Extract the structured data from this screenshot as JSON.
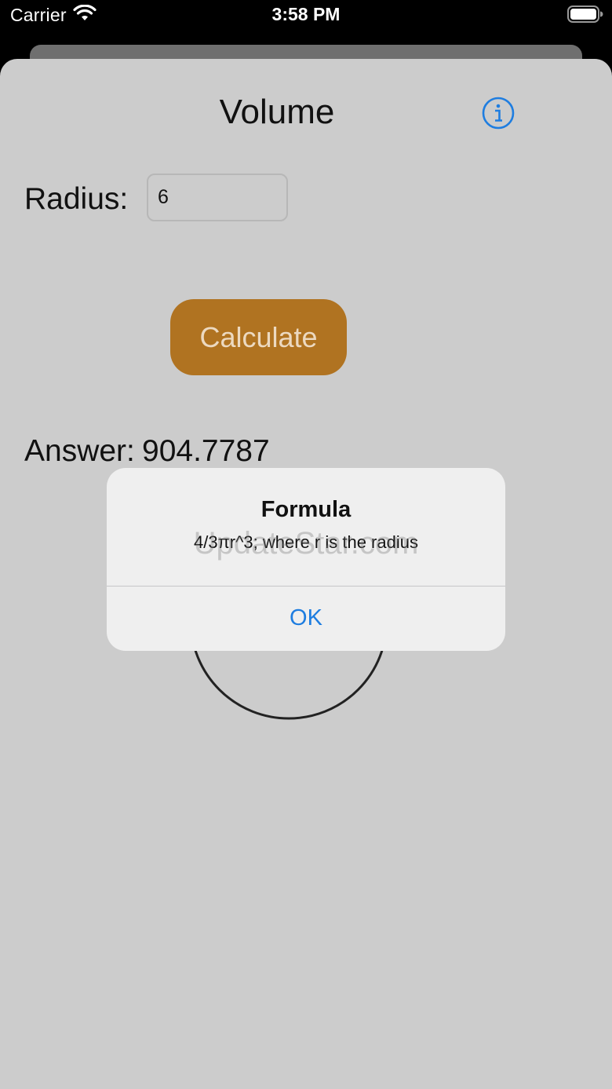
{
  "status_bar": {
    "carrier": "Carrier",
    "time": "3:58 PM",
    "icons": [
      "wifi-icon",
      "battery-icon"
    ]
  },
  "screen": {
    "title": "Volume",
    "info_icon": "info-circle-icon",
    "radius_label": "Radius:",
    "radius_value": "6",
    "calculate_label": "Calculate",
    "answer_label": "Answer:",
    "answer_value": "904.7787",
    "shape": "sphere-circle"
  },
  "alert": {
    "title": "Formula",
    "message": "4/3πr^3; where r is the radius",
    "ok_label": "OK"
  },
  "watermark": "UpdateStar.com",
  "colors": {
    "background": "#cccccc",
    "button": "#b07321",
    "button_text": "#ecd9c0",
    "accent": "#1e7de0",
    "alert_bg": "#efefef"
  }
}
